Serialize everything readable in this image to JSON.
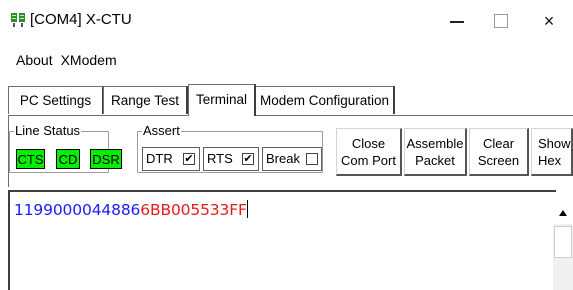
{
  "window": {
    "title": "[COM4] X-CTU",
    "icon": "xctu-app-icon",
    "controls": {
      "minimize": "minimize-icon",
      "maximize": "maximize-icon",
      "close": "×"
    }
  },
  "menu": {
    "items": [
      "About",
      "XModem"
    ]
  },
  "tabs": [
    {
      "label": "PC Settings",
      "active": false
    },
    {
      "label": "Range Test",
      "active": false
    },
    {
      "label": "Terminal",
      "active": true
    },
    {
      "label": "Modem Configuration",
      "active": false
    }
  ],
  "line_status": {
    "label": "Line Status",
    "indicators": [
      {
        "label": "CTS",
        "color": "#00ee00"
      },
      {
        "label": "CD",
        "color": "#00ee00"
      },
      {
        "label": "DSR",
        "color": "#00ee00"
      }
    ]
  },
  "assert": {
    "label": "Assert",
    "items": [
      {
        "label": "DTR",
        "checked": true,
        "mark": "✔"
      },
      {
        "label": "RTS",
        "checked": true,
        "mark": "✔"
      },
      {
        "label": "Break",
        "checked": false,
        "mark": ""
      }
    ]
  },
  "buttons": {
    "close_port": "Close\nCom Port",
    "assemble_packet": "Assemble\nPacket",
    "clear_screen": "Clear\nScreen",
    "show_hex": "Show\nHex"
  },
  "terminal": {
    "tx_text": "1199000044886",
    "rx_text": "6BB005533FF",
    "tx_color": "#1b1bff",
    "rx_color": "#e31b1b"
  }
}
